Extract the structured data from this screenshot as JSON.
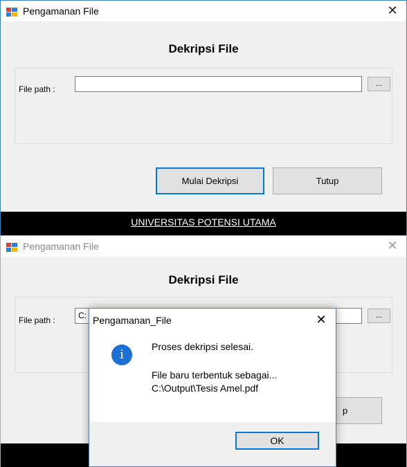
{
  "window1": {
    "title": "Pengamanan File",
    "heading": "Dekripsi File",
    "file_path_label": "File path :",
    "file_path_value": "",
    "browse_label": "...",
    "start_button": "Mulai Dekripsi",
    "close_button": "Tutup",
    "footer_link": "UNIVERSITAS POTENSI UTAMA"
  },
  "window2": {
    "title": "Pengamanan File",
    "heading": "Dekripsi File",
    "file_path_label": "File path :",
    "file_path_value": "C:",
    "browse_label": "...",
    "close_button_partial": "p"
  },
  "dialog": {
    "title": "Pengamanan_File",
    "icon": "info-icon",
    "line1": "Proses dekripsi selesai.",
    "line2": "File baru terbentuk sebagai...",
    "line3": "C:\\Output\\Tesis Amel.pdf",
    "ok_label": "OK"
  },
  "colors": {
    "accent": "#0078d7",
    "info_icon": "#1c6fd4",
    "footer_bar": "#000000"
  }
}
